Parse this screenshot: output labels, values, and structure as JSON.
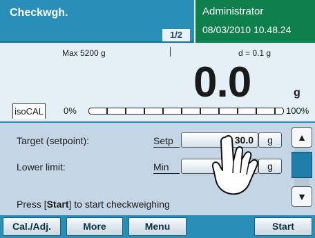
{
  "header": {
    "title": "Checkwgh.",
    "page_indicator": "1/2",
    "user": "Administrator",
    "datetime": "08/03/2010 10.48.24"
  },
  "display": {
    "max": "Max 5200 g",
    "d": "d = 0.1 g",
    "weight": "0.0",
    "unit": "g",
    "cal_tag": "isoCAL",
    "bar_low": "0%",
    "bar_high": "100%",
    "bar_fill_percent": 0
  },
  "params": {
    "rows": [
      {
        "label": "Target (setpoint):",
        "code": "Setp",
        "value": "30.0",
        "unit": "g"
      },
      {
        "label": "Lower limit:",
        "code": "Min",
        "value": "",
        "unit": "g"
      }
    ],
    "hint_prefix": "Press [",
    "hint_key": "Start",
    "hint_suffix": "] to start checkweighing"
  },
  "scroll": {
    "up": "▲",
    "down": "▼"
  },
  "softkeys": [
    "Cal./Adj.",
    "More",
    "Menu",
    "Start"
  ],
  "colors": {
    "header_blue": "#2a8fb8",
    "user_green": "#0f7f4d",
    "scroll_thumb": "#1f7fa8"
  },
  "icons": {
    "pointer": "hand-pointer-icon"
  }
}
